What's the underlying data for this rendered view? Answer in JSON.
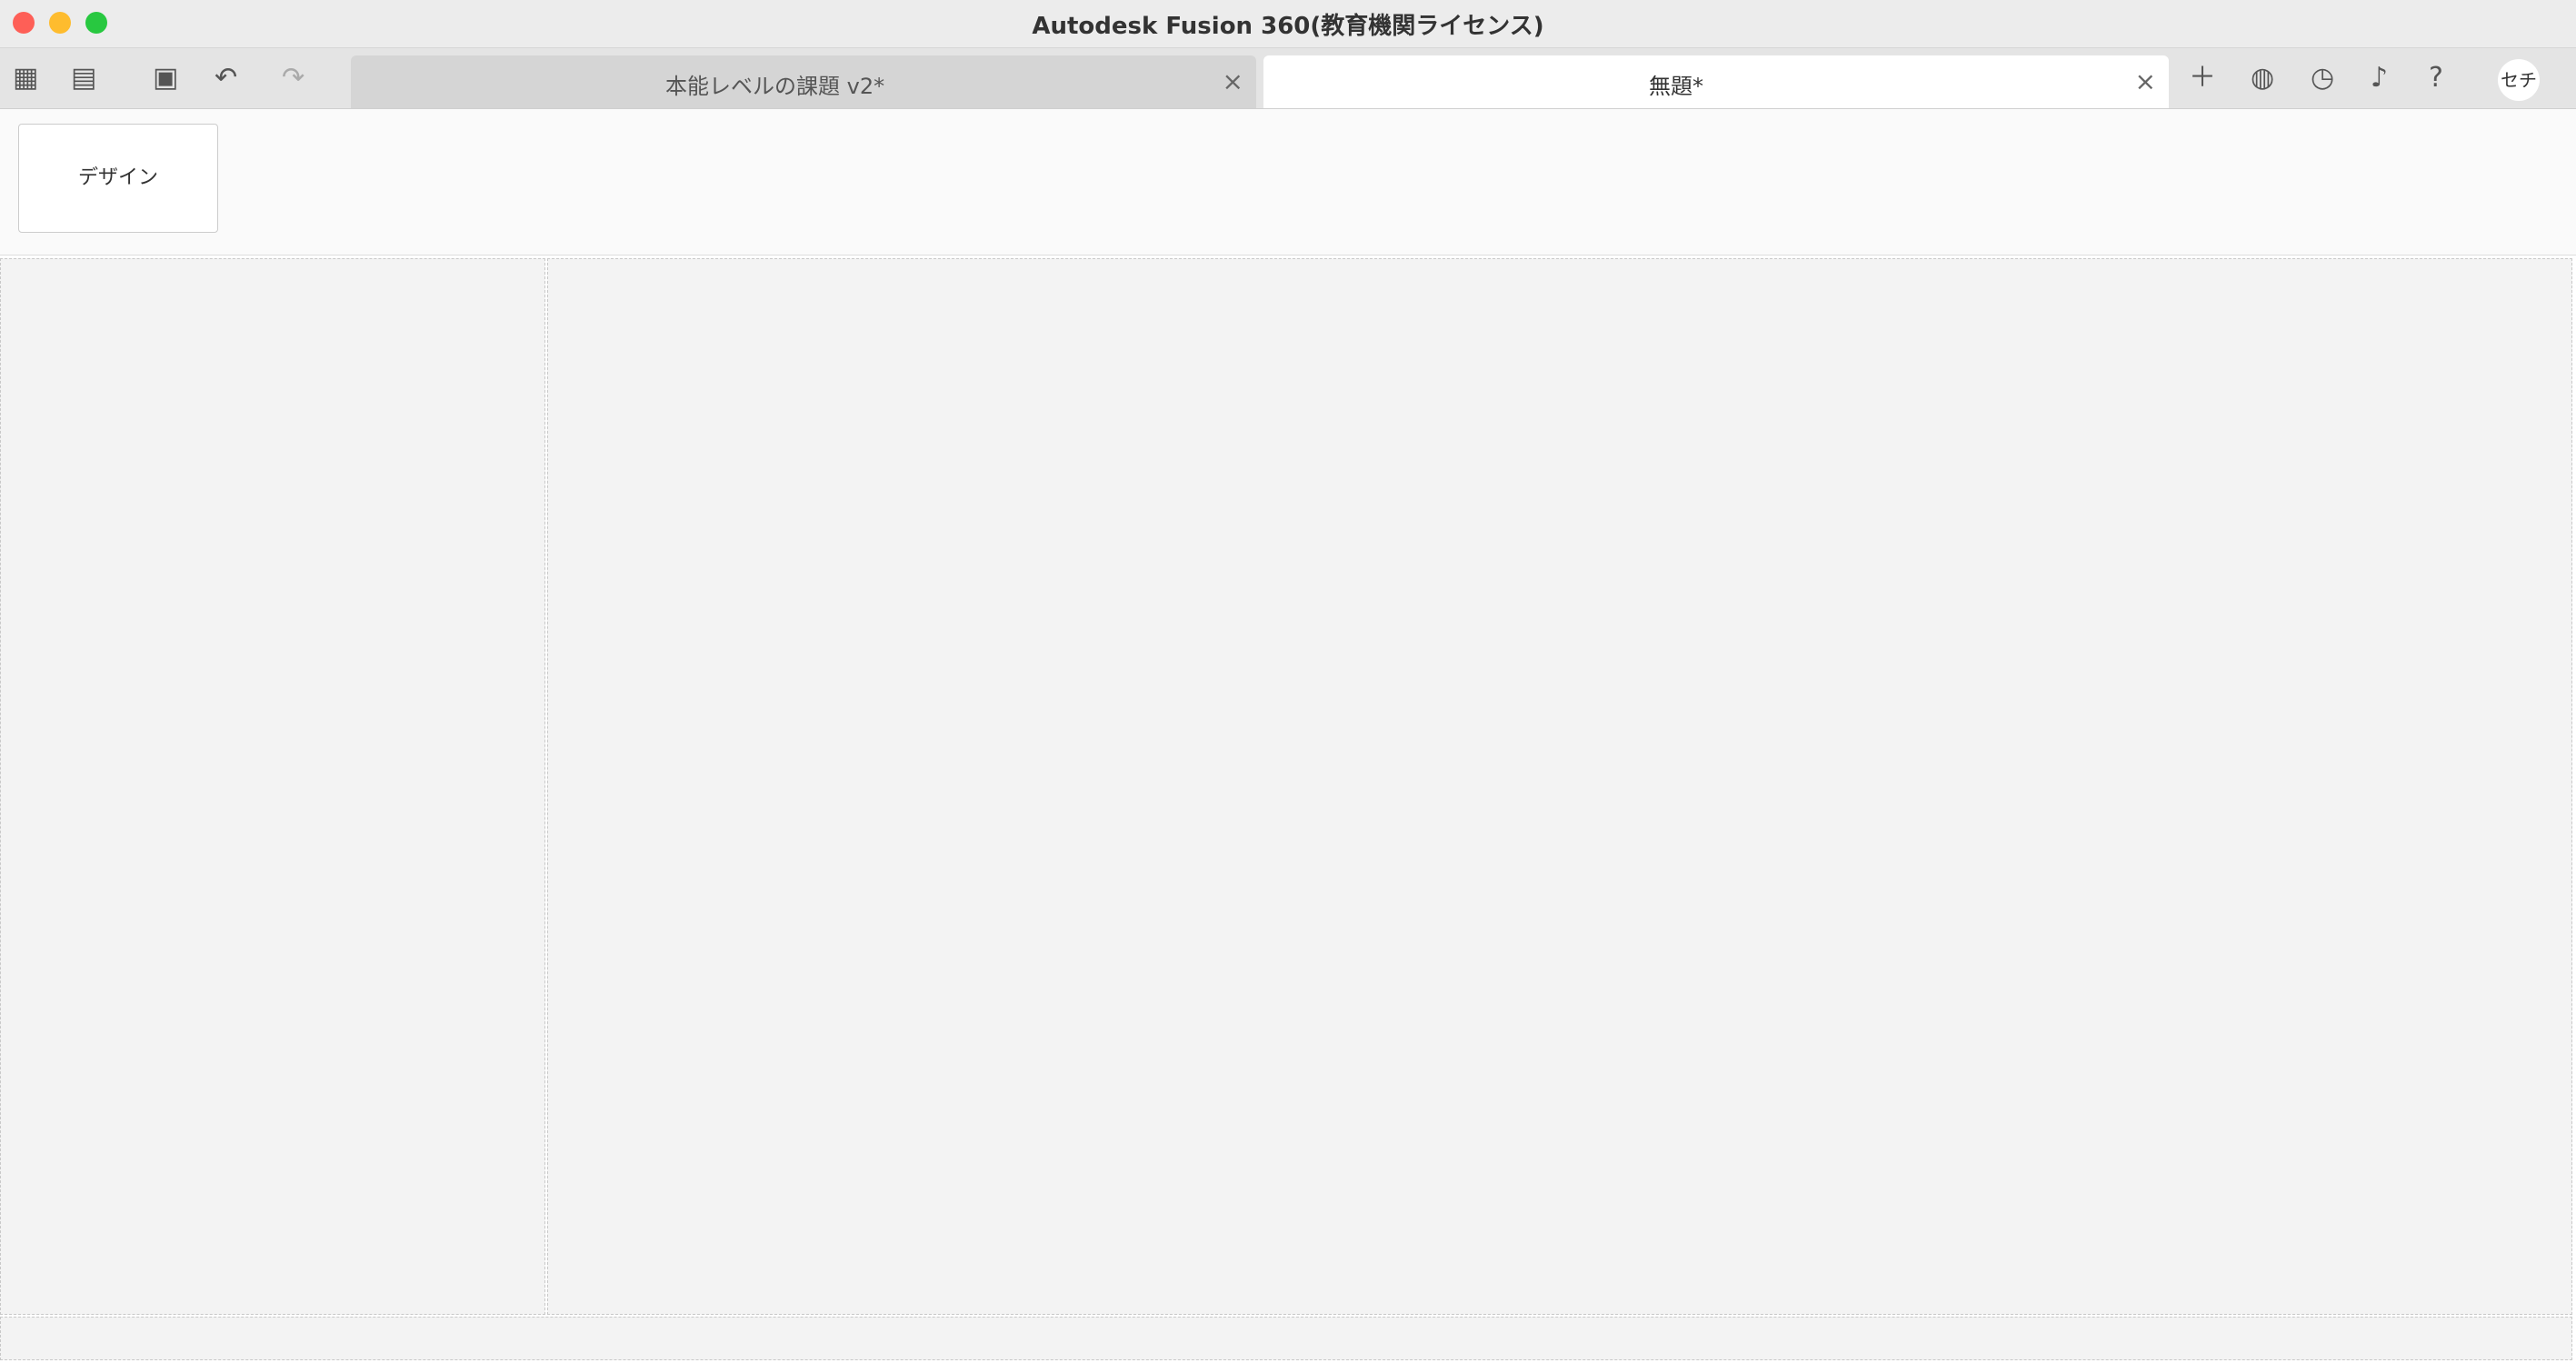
{
  "window": {
    "title": "Autodesk Fusion 360(教育機関ライセンス)"
  },
  "tabs": [
    {
      "label": "本能レベルの課題 v2*",
      "active": false
    },
    {
      "label": "無題*",
      "active": true
    }
  ],
  "header": {
    "user_initials": "セチ"
  },
  "toolbar": {
    "workspace": "デザイン"
  }
}
